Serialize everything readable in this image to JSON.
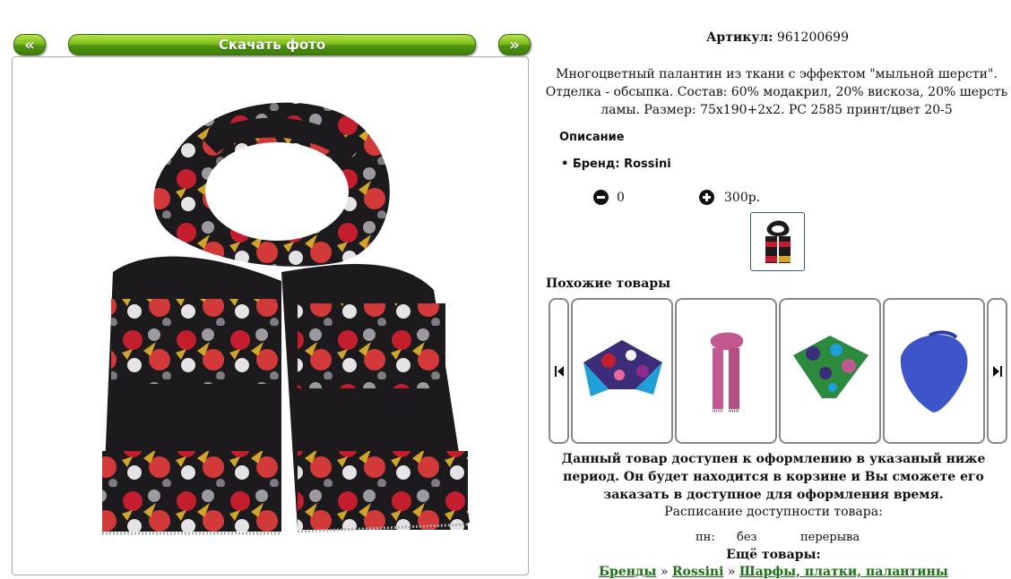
{
  "nav": {
    "prev_label": "«",
    "next_label": "»",
    "download_label": "Скачать фото"
  },
  "product": {
    "article_label": "Артикул:",
    "article_value": "961200699",
    "description": "Многоцветный палантин из ткани с эффектом \"мыльной шерсти\". Отделка - обсыпка. Состав: 60% модакрил, 20% вискоза, 20% шерсть ламы. Размер: 75x190+2x2. РС 2585 принт/цвет 20-5",
    "section_title": "Описание",
    "brand_item": "Бренд: Rossini",
    "quantity": "0",
    "price": "300р."
  },
  "similar": {
    "title": "Похожие товары"
  },
  "availability": {
    "notice": "Данный товар доступен к оформлению в указаный ниже период. Он будет находится в корзине и Вы сможете его заказать в доступное для оформления время.",
    "schedule_label": "Расписание доступности товара:",
    "day": "пн:",
    "from": "без",
    "to": "перерыва"
  },
  "more": {
    "title": "Ещё товары:",
    "crumb1": "Бренды",
    "sep": "»",
    "crumb2": "Rossini",
    "crumb3": "Шарфы, платки, палантины"
  },
  "colors": {
    "accent_green": "#5fa516",
    "link_green": "#1a6e12",
    "scarf_black": "#1c1a1c",
    "scarf_red": "#c41e2e",
    "scarf_yellow": "#d1a527"
  }
}
